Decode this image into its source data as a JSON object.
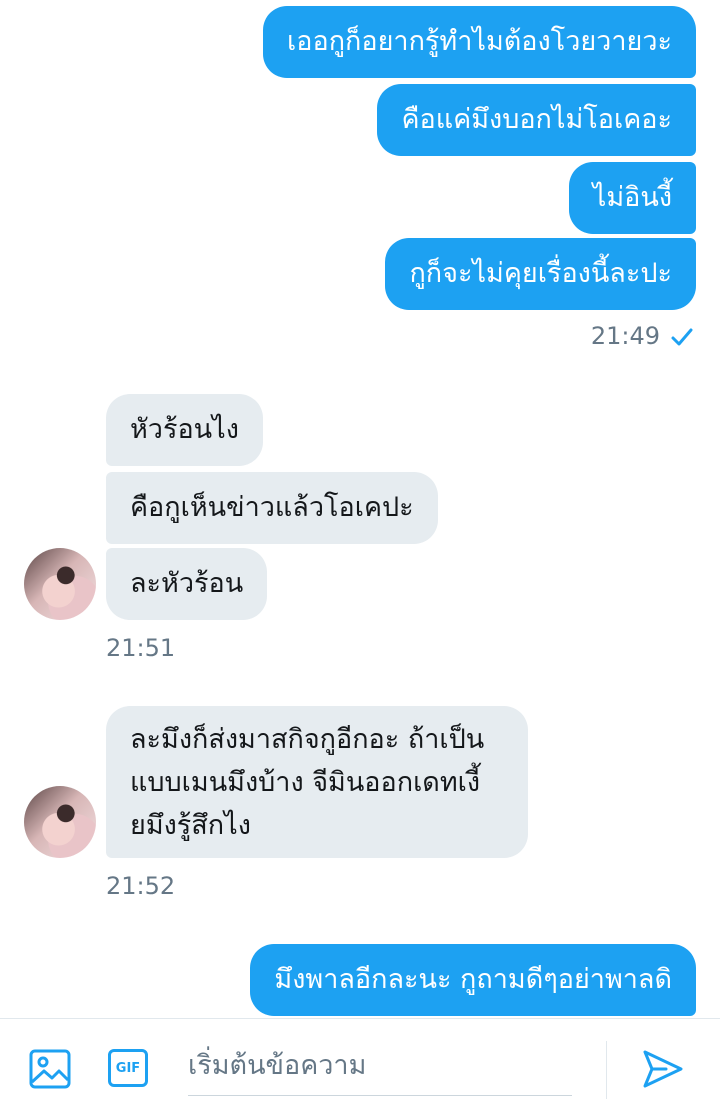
{
  "conversation": {
    "outgoing_1": [
      "เออกูก็อยากรู้ทำไมต้องโวยวายวะ",
      "คือแค่มึงบอกไม่โอเคอะ",
      "ไม่อินงี้",
      "กูก็จะไม่คุยเรื่องนี้ละปะ"
    ],
    "outgoing_1_time": "21:49",
    "outgoing_1_status_icon": "check-icon",
    "incoming_1": [
      "หัวร้อนไง",
      "คือกูเห็นข่าวแล้วโอเคปะ",
      "ละหัวร้อน"
    ],
    "incoming_1_time": "21:51",
    "incoming_2_lines": [
      "ละมึงก็ส่งมาสกิจกูอีกอะ ถ้าเป็น",
      "แบบเมนมึงบ้าง จีมินออกเดทเงี้",
      "ยมึงรู้สึกไง"
    ],
    "incoming_2_time": "21:52",
    "outgoing_2": "มึงพาลอีกละนะ กูถามดีๆอย่าพาลดิ"
  },
  "composer": {
    "placeholder": "เริ่มต้นข้อความ",
    "gif_label": "GIF",
    "icons": [
      "image-icon",
      "gif-icon",
      "send-icon"
    ]
  },
  "colors": {
    "accent": "#1da1f2",
    "incoming_bubble": "#e6ecf0",
    "timestamp": "#657786"
  }
}
